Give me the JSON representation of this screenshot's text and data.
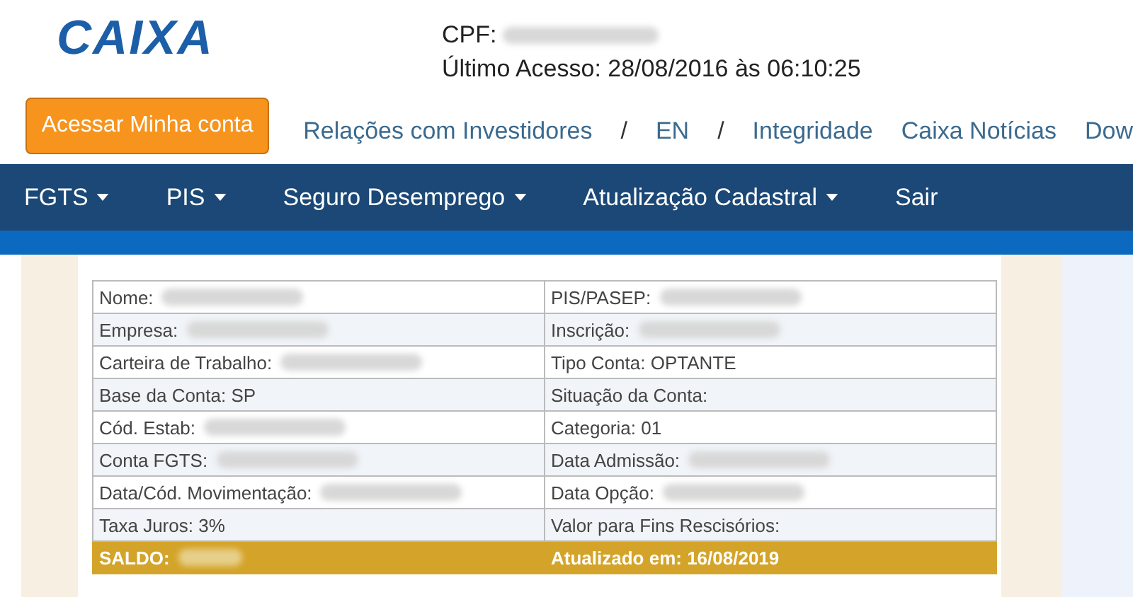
{
  "header": {
    "logo": "CAIXA",
    "cpf_label": "CPF:",
    "cpf_redacted": true,
    "last_access": "Último Acesso: 28/08/2016 às 06:10:25"
  },
  "account_button": "Acessar Minha conta",
  "top_links": [
    {
      "kind": "link",
      "text": "Relações com Investidores"
    },
    {
      "kind": "separator",
      "text": "/"
    },
    {
      "kind": "link",
      "text": "EN"
    },
    {
      "kind": "separator",
      "text": "/"
    },
    {
      "kind": "link",
      "text": "Integridade"
    },
    {
      "kind": "link",
      "text": "Caixa Notícias"
    },
    {
      "kind": "link",
      "text": "Dow"
    }
  ],
  "nav": [
    {
      "label": "FGTS",
      "dropdown": true
    },
    {
      "label": "PIS",
      "dropdown": true
    },
    {
      "label": "Seguro Desemprego",
      "dropdown": true
    },
    {
      "label": "Atualização Cadastral",
      "dropdown": true
    },
    {
      "label": "Sair",
      "dropdown": false
    }
  ],
  "table": {
    "rows": [
      {
        "kind": "normal",
        "cells": [
          {
            "text": "Nome:",
            "redacted": true
          },
          {
            "text": "PIS/PASEP:",
            "redacted": true
          }
        ]
      },
      {
        "kind": "normal",
        "cells": [
          {
            "text": "Empresa:",
            "redacted": true
          },
          {
            "text": "Inscrição:",
            "redacted": true
          }
        ]
      },
      {
        "kind": "normal",
        "cells": [
          {
            "text": "Carteira de Trabalho:",
            "redacted": true
          },
          {
            "text": "Tipo Conta: OPTANTE",
            "redacted": false
          }
        ]
      },
      {
        "kind": "normal",
        "cells": [
          {
            "text": "Base da Conta: SP",
            "redacted": false
          },
          {
            "text": "Situação da Conta:",
            "redacted": false
          }
        ]
      },
      {
        "kind": "normal",
        "cells": [
          {
            "text": "Cód. Estab:",
            "redacted": true
          },
          {
            "text": "Categoria: 01",
            "redacted": false
          }
        ]
      },
      {
        "kind": "normal",
        "cells": [
          {
            "text": "Conta FGTS:",
            "redacted": true
          },
          {
            "text": "Data Admissão:",
            "redacted": true
          }
        ]
      },
      {
        "kind": "normal",
        "cells": [
          {
            "text": "Data/Cód. Movimentação:",
            "redacted": true
          },
          {
            "text": "Data Opção:",
            "redacted": true
          }
        ]
      },
      {
        "kind": "normal",
        "cells": [
          {
            "text": "Taxa Juros: 3%",
            "redacted": false
          },
          {
            "text": "Valor para Fins Rescisórios:",
            "redacted": false
          }
        ]
      },
      {
        "kind": "total",
        "cells": [
          {
            "text": "SALDO:",
            "redacted": true
          },
          {
            "text": "Atualizado em: 16/08/2019",
            "redacted": false
          }
        ]
      }
    ]
  }
}
